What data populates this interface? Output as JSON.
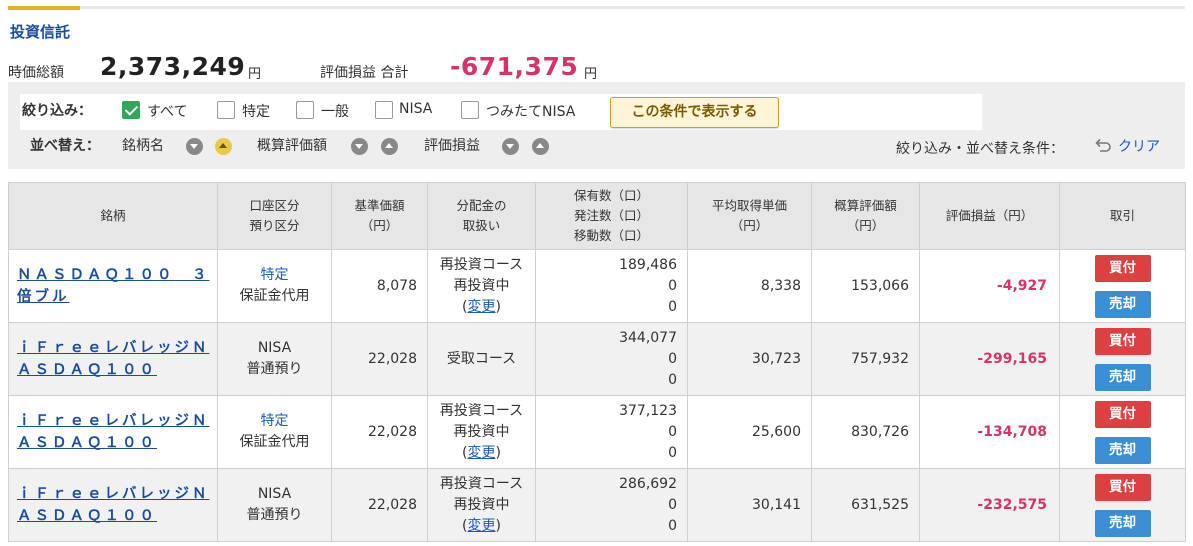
{
  "section_title": "投資信託",
  "summary": {
    "market_value_label": "時価総額",
    "market_value": "2,373,249",
    "market_value_unit": "円",
    "pl_label": "評価損益 合計",
    "pl_value": "-671,375",
    "pl_unit": "円"
  },
  "filter": {
    "label": "絞り込み：",
    "options": [
      {
        "label": "すべて",
        "checked": true
      },
      {
        "label": "特定",
        "checked": false
      },
      {
        "label": "一般",
        "checked": false
      },
      {
        "label": "NISA",
        "checked": false
      },
      {
        "label": "つみたてNISA",
        "checked": false
      }
    ],
    "apply_button": "この条件で表示する"
  },
  "sort": {
    "label": "並べ替え：",
    "keys": [
      "銘柄名",
      "概算評価額",
      "評価損益"
    ],
    "condition_label": "絞り込み・並べ替え条件：",
    "clear_label": "クリア"
  },
  "table": {
    "headers": {
      "name": "銘柄",
      "account_1": "口座区分",
      "account_2": "預り区分",
      "nav_1": "基準価額",
      "nav_2": "（円）",
      "dist_1": "分配金の",
      "dist_2": "取扱い",
      "qty_1": "保有数（口）",
      "qty_2": "発注数（口）",
      "qty_3": "移動数（口）",
      "avg_1": "平均取得単価",
      "avg_2": "（円）",
      "val_1": "概算評価額",
      "val_2": "（円）",
      "pl": "評価損益（円）",
      "trade": "取引"
    },
    "rows": [
      {
        "name": "ＮＡＳＤＡＱ１００　３倍ブル",
        "account": "特定",
        "deposit": "保証金代用",
        "nav": "8,078",
        "dist_1": "再投資コース",
        "dist_2": "再投資中",
        "dist_change": "変更",
        "held": "189,486",
        "ordered": "0",
        "moved": "0",
        "avg_price": "8,338",
        "est_value": "153,066",
        "pl": "-4,927",
        "buy": "買付",
        "sell": "売却"
      },
      {
        "name": "ｉＦｒｅｅレバレッジＮＡＳＤＡＱ１００",
        "account": "NISA",
        "deposit": "普通預り",
        "nav": "22,028",
        "dist_1": "受取コース",
        "dist_2": "",
        "dist_change": "",
        "held": "344,077",
        "ordered": "0",
        "moved": "0",
        "avg_price": "30,723",
        "est_value": "757,932",
        "pl": "-299,165",
        "buy": "買付",
        "sell": "売却"
      },
      {
        "name": "ｉＦｒｅｅレバレッジＮＡＳＤＡＱ１００",
        "account": "特定",
        "deposit": "保証金代用",
        "nav": "22,028",
        "dist_1": "再投資コース",
        "dist_2": "再投資中",
        "dist_change": "変更",
        "held": "377,123",
        "ordered": "0",
        "moved": "0",
        "avg_price": "25,600",
        "est_value": "830,726",
        "pl": "-134,708",
        "buy": "買付",
        "sell": "売却"
      },
      {
        "name": "ｉＦｒｅｅレバレッジＮＡＳＤＡＱ１００",
        "account": "NISA",
        "deposit": "普通預り",
        "nav": "22,028",
        "dist_1": "再投資コース",
        "dist_2": "再投資中",
        "dist_change": "変更",
        "held": "286,692",
        "ordered": "0",
        "moved": "0",
        "avg_price": "30,141",
        "est_value": "631,525",
        "pl": "-232,575",
        "buy": "買付",
        "sell": "売却"
      }
    ]
  },
  "colors": {
    "title_blue": "#1a4e9c",
    "negative": "#d6336c",
    "accent": "#e6b422",
    "buy": "#dc4040",
    "sell": "#3a8fd4",
    "check": "#2fa85c"
  }
}
